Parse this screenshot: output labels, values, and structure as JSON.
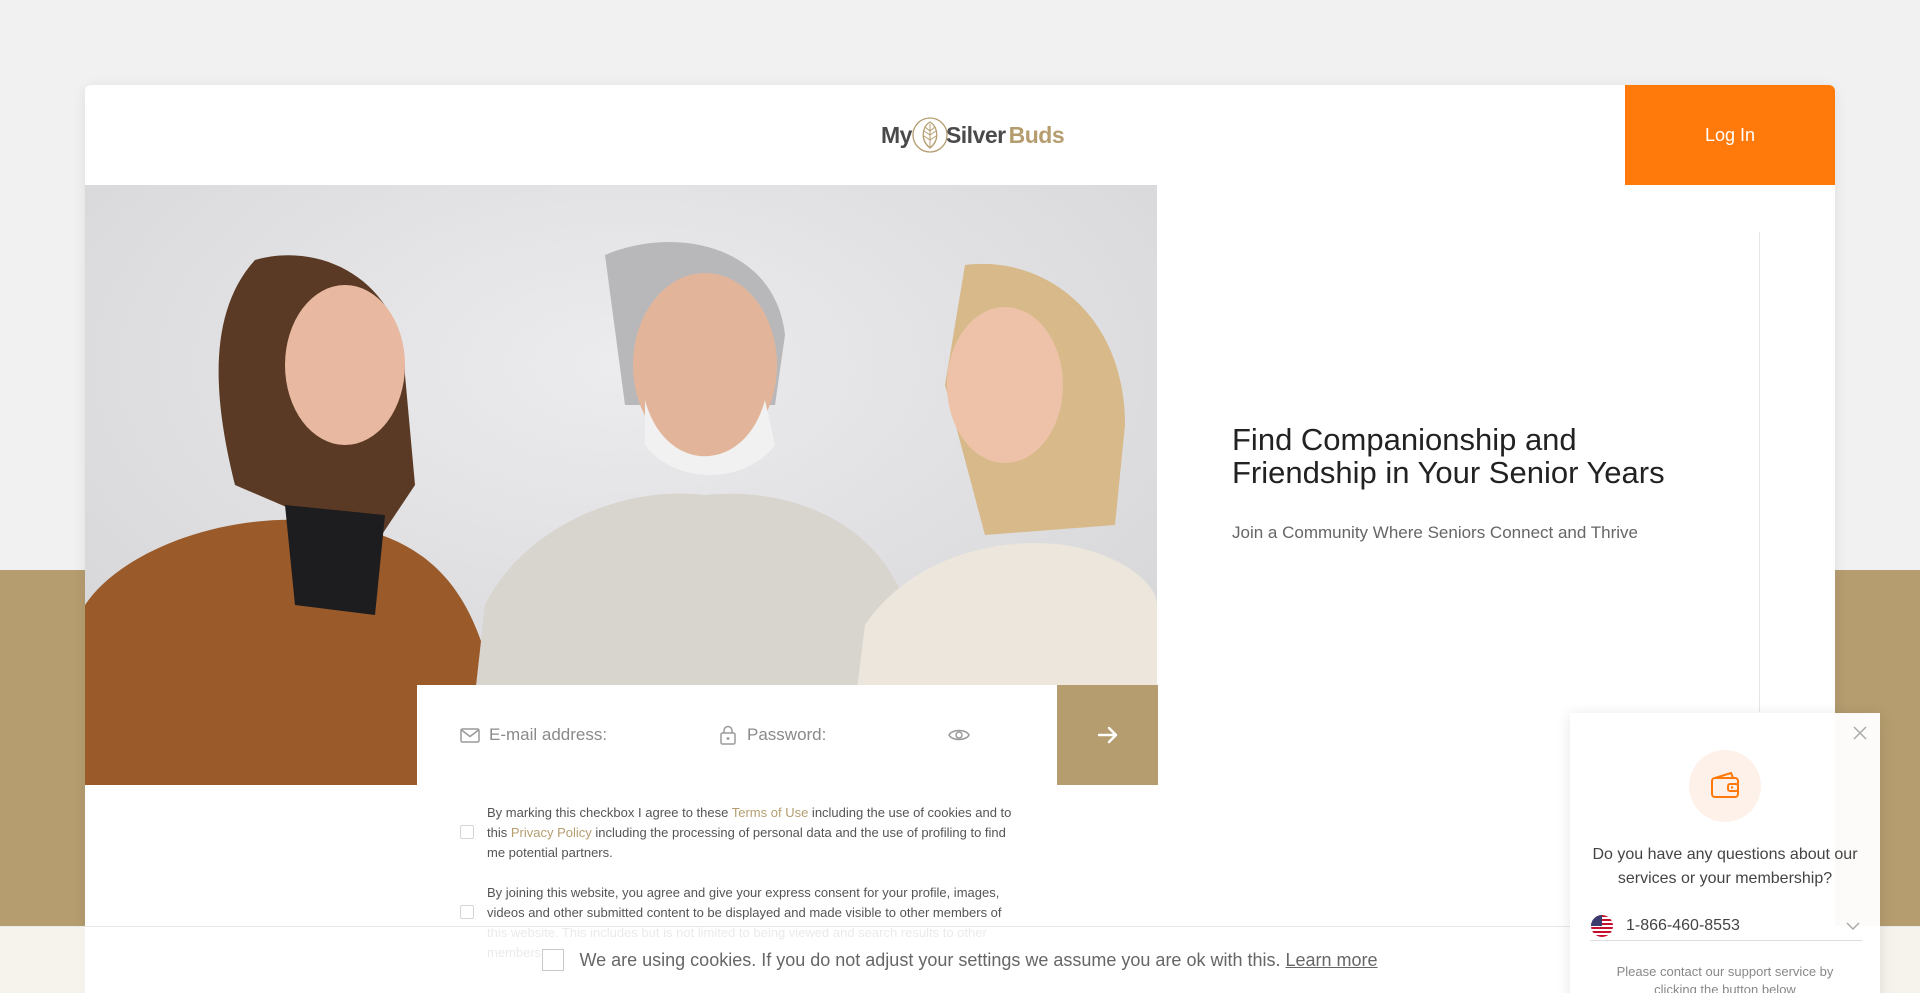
{
  "brand": {
    "logo_my": "My",
    "logo_silver": "Silver",
    "logo_buds": "Buds",
    "accent_color": "#b59d6f",
    "cta_color": "#ff7a0b"
  },
  "header": {
    "login_label": "Log In"
  },
  "hero": {
    "headline": "Find Companionship and Friendship in Your Senior Years",
    "subheadline": "Join a Community Where Seniors Connect and Thrive"
  },
  "form": {
    "email_placeholder": "E-mail address:",
    "password_placeholder": "Password:",
    "email_icon": "envelope-icon",
    "password_icon": "lock-icon",
    "toggle_icon": "eye-icon",
    "submit_icon": "arrow-right-icon"
  },
  "consents": {
    "terms": {
      "before": "By marking this checkbox I agree to these ",
      "link1": "Terms of Use",
      "middle": " including the use of cookies and to this ",
      "link2": "Privacy Policy",
      "after": " including the processing of personal data and the use of profiling to find me potential partners."
    },
    "content": {
      "text": "By joining this website, you agree and give your express consent for your profile, images, videos and other submitted content to be displayed and made visible to other members of this website. This includes but is not limited to being viewed and search results to other members."
    }
  },
  "cookie_bar": {
    "text": "We are using cookies. If you do not adjust your settings we assume you are ok with this.",
    "link": "Learn more"
  },
  "support_widget": {
    "question": "Do you have any questions about our services or your membership?",
    "phone": "1-866-460-8553",
    "note": "Please contact our support service by clicking the button below",
    "icon": "wallet-icon",
    "flag_icon": "us-flag-icon"
  }
}
